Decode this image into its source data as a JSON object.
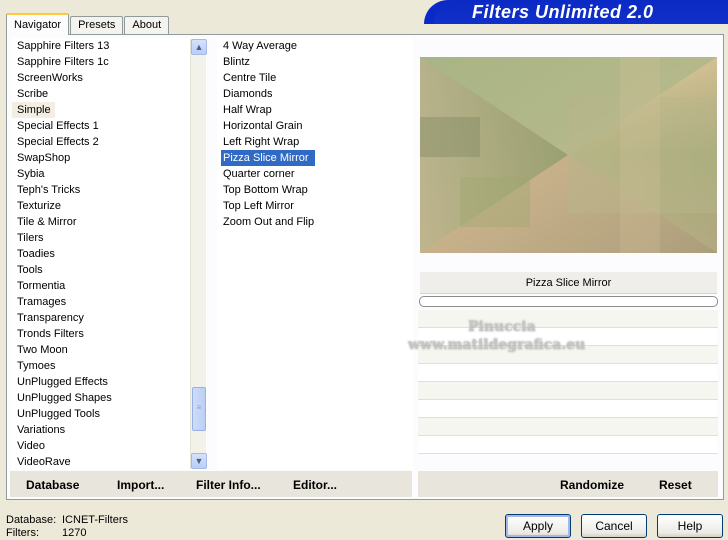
{
  "tabs": [
    {
      "label": "Navigator",
      "active": true
    },
    {
      "label": "Presets",
      "active": false
    },
    {
      "label": "About",
      "active": false
    }
  ],
  "app_title": "Filters Unlimited 2.0",
  "categories": {
    "items": [
      "Sapphire Filters 13",
      "Sapphire Filters 1c",
      "ScreenWorks",
      "Scribe",
      "Simple",
      "Special Effects 1",
      "Special Effects 2",
      "SwapShop",
      "Sybia",
      "Teph's Tricks",
      "Texturize",
      "Tile & Mirror",
      "Tilers",
      "Toadies",
      "Tools",
      "Tormentia",
      "Tramages",
      "Transparency",
      "Tronds Filters",
      "Two Moon",
      "Tymoes",
      "UnPlugged Effects",
      "UnPlugged Shapes",
      "UnPlugged Tools",
      "Variations",
      "Video",
      "VideoRave"
    ],
    "selected": "Simple"
  },
  "filters": {
    "items": [
      "4 Way Average",
      "Blintz",
      "Centre Tile",
      "Diamonds",
      "Half Wrap",
      "Horizontal Grain",
      "Left Right Wrap",
      "Pizza Slice Mirror",
      "Quarter corner",
      "Top Bottom Wrap",
      "Top Left Mirror",
      "Zoom Out and Flip"
    ],
    "selected": "Pizza Slice Mirror"
  },
  "preview": {
    "filter_name": "Pizza Slice Mirror",
    "watermark_line1": "Pinuccia",
    "watermark_line2": "www.matildegrafica.eu"
  },
  "linkbar": {
    "database": "Database",
    "import": "Import...",
    "filter_info": "Filter Info...",
    "editor": "Editor...",
    "randomize": "Randomize",
    "reset": "Reset"
  },
  "status": {
    "database_label": "Database:",
    "database_value": "ICNET-Filters",
    "filters_label": "Filters:",
    "filters_value": "1270"
  },
  "buttons": {
    "apply": "Apply",
    "cancel": "Cancel",
    "help": "Help"
  },
  "colors": {
    "title_bar": "#0a2ac8",
    "selection": "#316ac5",
    "tab_accent": "#ffc83c"
  }
}
